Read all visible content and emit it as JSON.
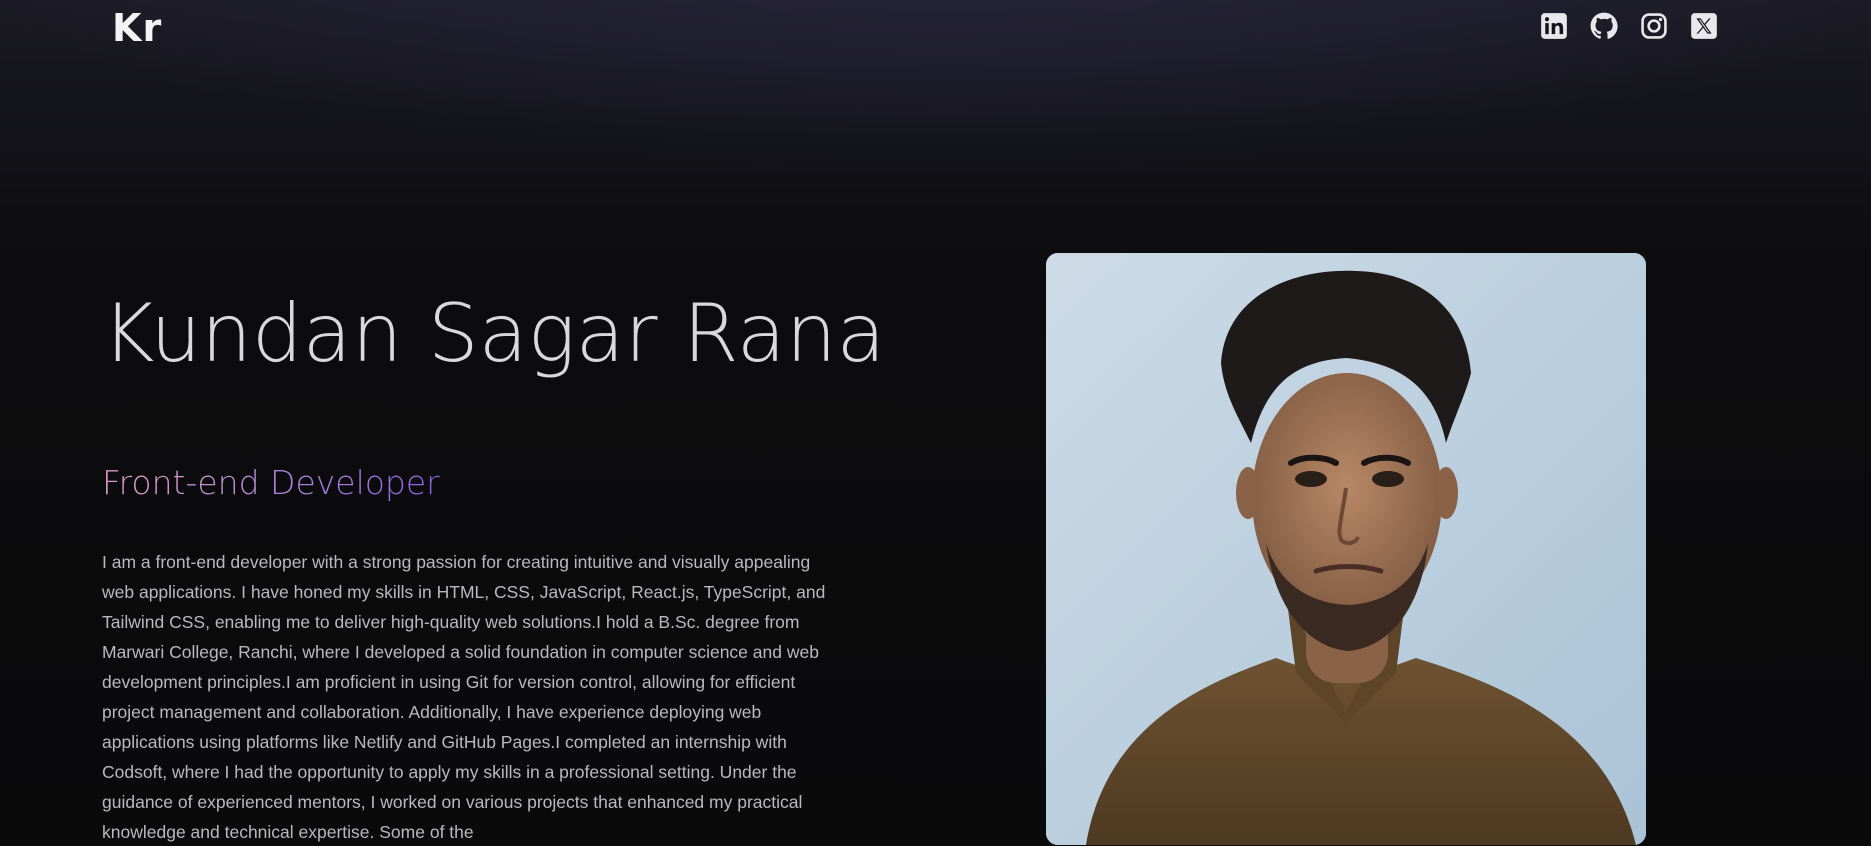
{
  "nav": {
    "logo": "Kr",
    "socials": [
      {
        "name": "linkedin-icon"
      },
      {
        "name": "github-icon"
      },
      {
        "name": "instagram-icon"
      },
      {
        "name": "x-icon"
      }
    ]
  },
  "hero": {
    "name": "Kundan Sagar Rana",
    "role": "Front-end Developer",
    "bio": "I am a front-end developer with a strong passion for creating intuitive and visually appealing web applications. I have honed my skills in HTML, CSS, JavaScript, React.js, TypeScript, and Tailwind CSS, enabling me to deliver high-quality web solutions.I hold a B.Sc. degree from Marwari College, Ranchi, where I developed a solid foundation in computer science and web development principles.I am proficient in using Git for version control, allowing for efficient project management and collaboration. Additionally, I have experience deploying web applications using platforms like Netlify and GitHub Pages.I completed an internship with Codsoft, where I had the opportunity to apply my skills in a professional setting. Under the guidance of experienced mentors, I worked on various projects that enhanced my practical knowledge and technical expertise. Some of the"
  },
  "colors": {
    "background": "#0b0b0d",
    "role_gradient_start": "#e39cc6",
    "role_gradient_end": "#8f5fe6",
    "icon": "#e8e8ec"
  }
}
